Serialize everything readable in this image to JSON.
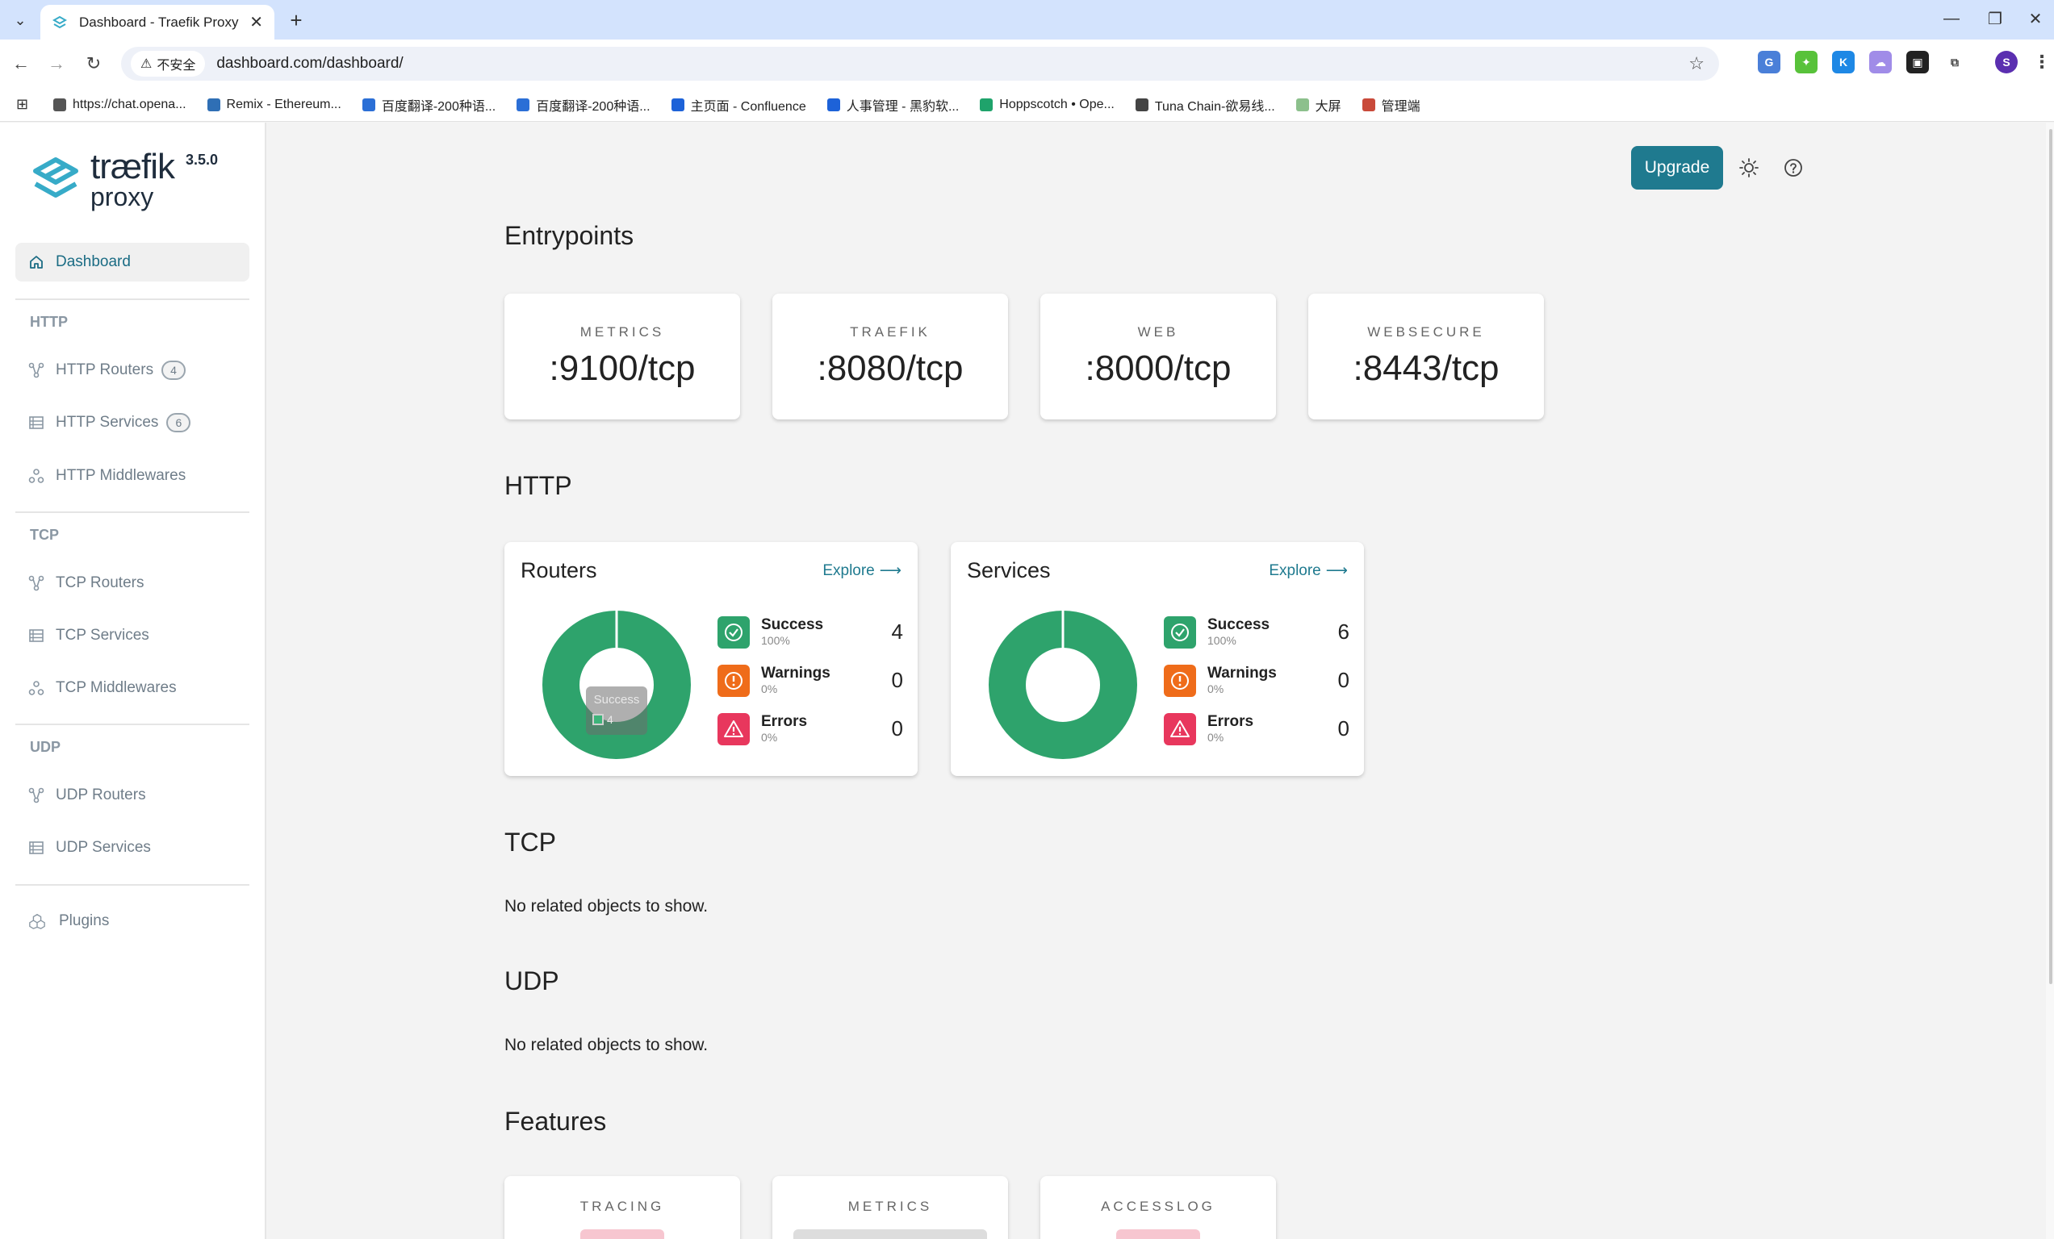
{
  "browser": {
    "tab_title": "Dashboard - Traefik Proxy",
    "security_label": "不安全",
    "url": "dashboard.com/dashboard/",
    "bookmarks": [
      {
        "label": "https://chat.opena...",
        "color": "#555555"
      },
      {
        "label": "Remix - Ethereum...",
        "color": "#2f6fb5"
      },
      {
        "label": "百度翻译-200种语...",
        "color": "#2b6fd6"
      },
      {
        "label": "百度翻译-200种语...",
        "color": "#2b6fd6"
      },
      {
        "label": "主页面 - Confluence",
        "color": "#1d62d8"
      },
      {
        "label": "人事管理 - 黑豹软...",
        "color": "#1d62d8"
      },
      {
        "label": "Hoppscotch • Ope...",
        "color": "#1fa36b"
      },
      {
        "label": "Tuna Chain-欲易线...",
        "color": "#444444"
      },
      {
        "label": "大屏",
        "color": "#8cc08c"
      },
      {
        "label": "管理端",
        "color": "#c94a3a"
      }
    ]
  },
  "sidebar": {
    "logo_line1": "træfik",
    "logo_line2": "proxy",
    "version": "3.5.0",
    "active_item": "Dashboard",
    "sections": {
      "http": "HTTP",
      "tcp": "TCP",
      "udp": "UDP"
    },
    "http_items": [
      {
        "label": "HTTP Routers",
        "badge": "4"
      },
      {
        "label": "HTTP Services",
        "badge": "6"
      },
      {
        "label": "HTTP Middlewares",
        "badge": ""
      }
    ],
    "tcp_items": [
      {
        "label": "TCP Routers"
      },
      {
        "label": "TCP Services"
      },
      {
        "label": "TCP Middlewares"
      }
    ],
    "udp_items": [
      {
        "label": "UDP Routers"
      },
      {
        "label": "UDP Services"
      }
    ],
    "plugins": "Plugins"
  },
  "header": {
    "upgrade_label": "Upgrade"
  },
  "entrypoints": {
    "title": "Entrypoints",
    "cards": [
      {
        "name": "METRICS",
        "address": ":9100/tcp"
      },
      {
        "name": "TRAEFIK",
        "address": ":8080/tcp"
      },
      {
        "name": "WEB",
        "address": ":8000/tcp"
      },
      {
        "name": "WEBSECURE",
        "address": ":8443/tcp"
      }
    ]
  },
  "http": {
    "title": "HTTP",
    "explore_label": "Explore",
    "routers": {
      "title": "Routers",
      "stats": [
        {
          "name": "Success",
          "pct": "100%",
          "count": "4",
          "color": "#2ea36c"
        },
        {
          "name": "Warnings",
          "pct": "0%",
          "count": "0",
          "color": "#ef6c1a"
        },
        {
          "name": "Errors",
          "pct": "0%",
          "count": "0",
          "color": "#e8375d"
        }
      ],
      "tooltip_label": "Success",
      "tooltip_value": "4"
    },
    "services": {
      "title": "Services",
      "stats": [
        {
          "name": "Success",
          "pct": "100%",
          "count": "6",
          "color": "#2ea36c"
        },
        {
          "name": "Warnings",
          "pct": "0%",
          "count": "0",
          "color": "#ef6c1a"
        },
        {
          "name": "Errors",
          "pct": "0%",
          "count": "0",
          "color": "#e8375d"
        }
      ]
    }
  },
  "tcp": {
    "title": "TCP",
    "empty_text": "No related objects to show."
  },
  "udp": {
    "title": "UDP",
    "empty_text": "No related objects to show."
  },
  "features": {
    "title": "Features",
    "cards": [
      {
        "name": "TRACING",
        "pill_color": "#f7c6d0"
      },
      {
        "name": "METRICS",
        "pill_color": "#dddddd"
      },
      {
        "name": "ACCESSLOG",
        "pill_color": "#f7c6d0"
      }
    ]
  },
  "colors": {
    "accent": "#1f7a8f",
    "success": "#2ea36c",
    "warning": "#ef6c1a",
    "error": "#e8375d"
  }
}
